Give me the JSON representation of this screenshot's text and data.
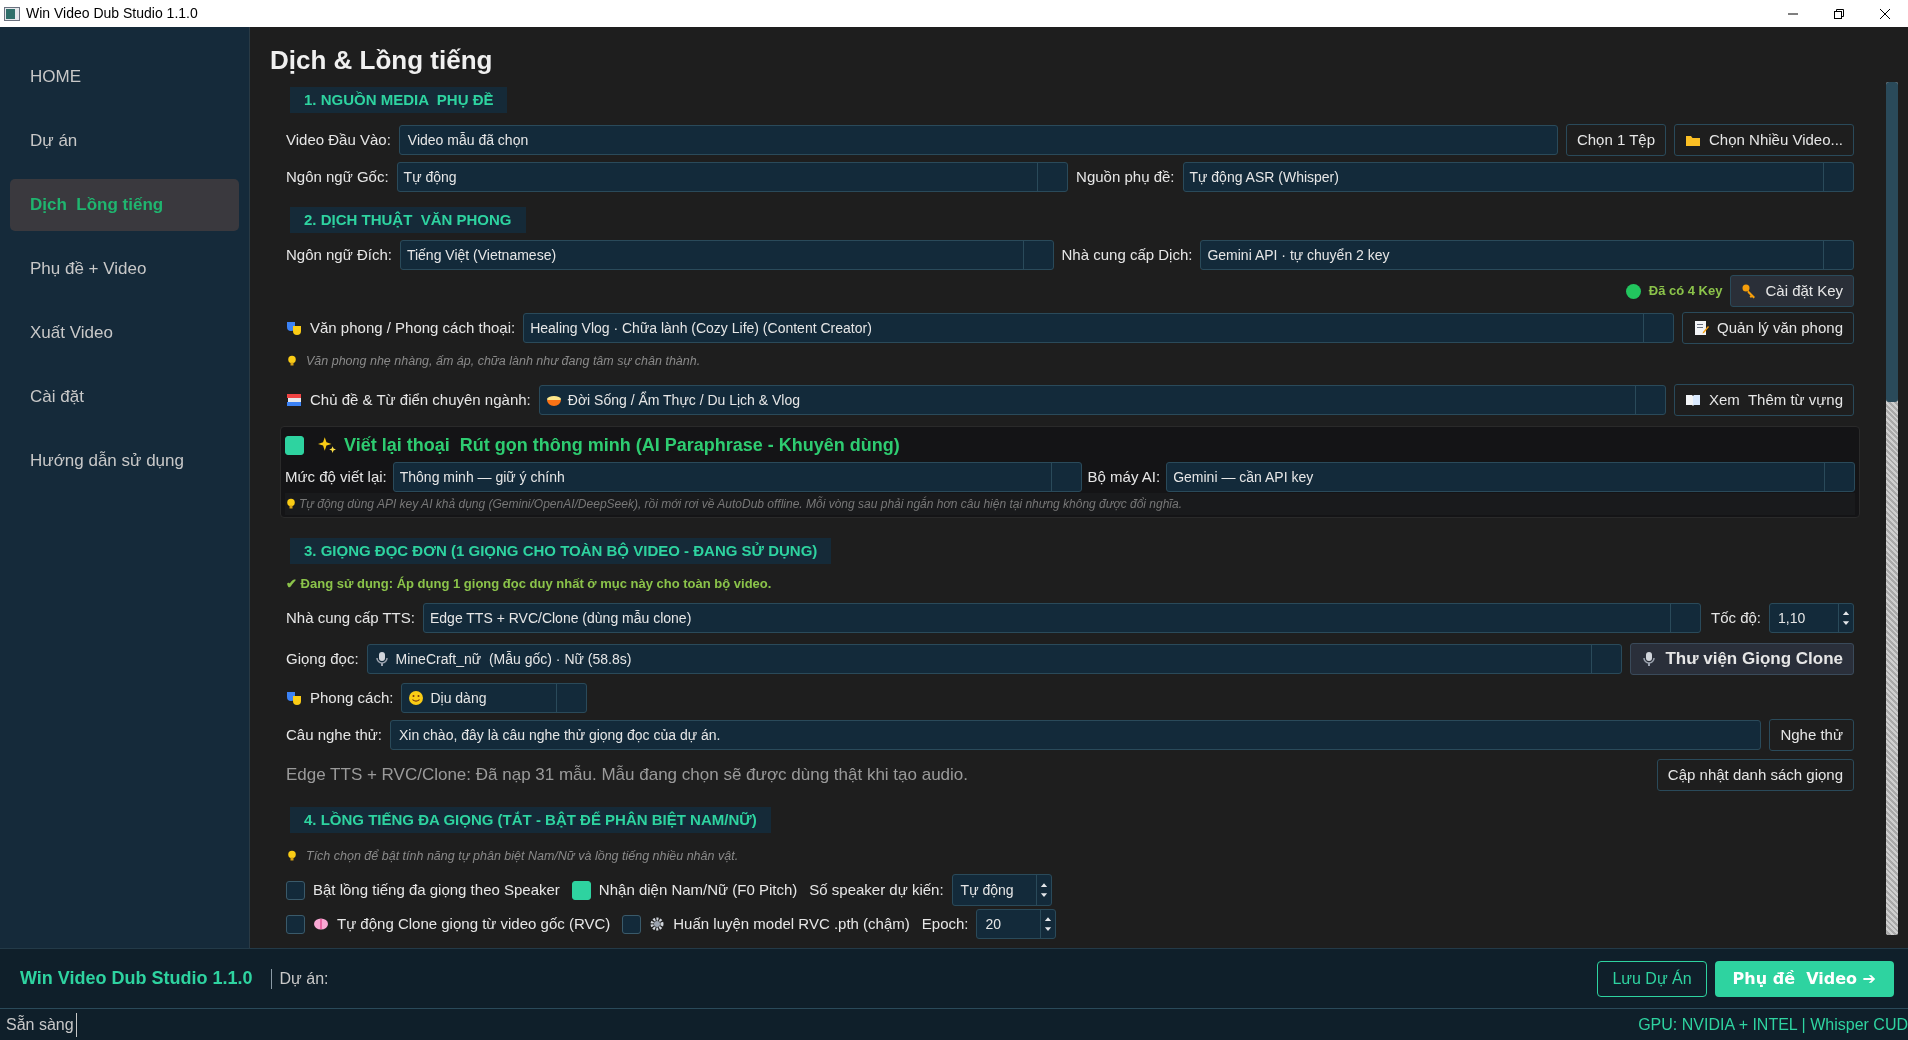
{
  "window": {
    "title": "Win Video Dub Studio 1.1.0"
  },
  "sidebar": {
    "items": [
      {
        "label": "HOME",
        "selected": false
      },
      {
        "label": "Dự án",
        "selected": false
      },
      {
        "label": "Dịch  Lồng tiếng",
        "selected": true
      },
      {
        "label": "Phụ đề + Video",
        "selected": false
      },
      {
        "label": "Xuất Video",
        "selected": false
      },
      {
        "label": "Cài đặt",
        "selected": false
      },
      {
        "label": "Hướng dẫn sử dụng",
        "selected": false
      }
    ]
  },
  "page_title": "Dịch & Lồng tiếng",
  "source_section": {
    "title": "1. NGUỒN MEDIA  PHỤ ĐỀ",
    "video_input": {
      "label": "Video Đầu Vào:",
      "value": "Video mẫu đã chọn"
    },
    "choose_file_button": "Chọn 1 Tệp",
    "choose_many_button": "Chọn Nhiều Video...",
    "source_language": {
      "label": "Ngôn ngữ Gốc:",
      "value": "Tự động"
    },
    "subtitle_source": {
      "label": "Nguồn phụ đề:",
      "value": "Tự động ASR (Whisper)"
    }
  },
  "translation_section": {
    "title": "2. DỊCH THUẬT  VĂN PHONG",
    "target_language": {
      "label": "Ngôn ngữ Đích:",
      "value": "Tiếng Việt (Vietnamese)"
    },
    "provider": {
      "label": "Nhà cung cấp Dịch:",
      "value": "Gemini API · tự chuyển 2 key"
    },
    "key_status": "Đã có 4 Key",
    "key_button": "Cài đặt Key",
    "style": {
      "label": "Văn phong / Phong cách thoại:",
      "value": "Healing Vlog · Chữa lành (Cozy Life) (Content Creator)"
    },
    "style_button": "Quản lý văn phong",
    "style_hint": "Văn phong nhẹ nhàng, ấm áp, chữa lành như đang tâm sự chân thành.",
    "topic": {
      "label": "Chủ đề & Từ điển chuyên ngành:",
      "value": "Đời Sống / Ẩm Thực / Du Lịch & Vlog"
    },
    "vocab_button": "Xem  Thêm từ vựng",
    "paraphrase": {
      "checked": true,
      "title": "Viết lại thoại  Rút gọn thông minh (AI Paraphrase - Khuyên dùng)",
      "rewrite_level": {
        "label": "Mức độ viết lại:",
        "value": "Thông minh — giữ ý chính"
      },
      "engine": {
        "label": "Bộ máy AI:",
        "value": "Gemini — cần API key"
      },
      "hint": "Tự động dùng API key AI khả dụng (Gemini/OpenAI/DeepSeek), rồi mới rơi về AutoDub offline. Mỗi vòng sau phải ngắn hơn câu hiện tại nhưng không được đổi nghĩa."
    }
  },
  "voice_section": {
    "title": "3. GIỌNG ĐỌC ĐƠN (1 GIỌNG CHO TOÀN BỘ VIDEO - ĐANG SỬ DỤNG)",
    "note": "✔ Đang sử dụng: Áp dụng 1 giọng đọc duy nhất ở mục này cho toàn bộ video.",
    "tts_provider": {
      "label": "Nhà cung cấp TTS:",
      "value": "Edge TTS + RVC/Clone (dùng mẫu clone)"
    },
    "speed": {
      "label": "Tốc độ:",
      "value": "1,10"
    },
    "voice": {
      "label": "Giọng đọc:",
      "value": "MineCraft_nữ  (Mẫu gốc) · Nữ (58.8s)"
    },
    "clone_library_button": "Thư viện Giọng Clone",
    "style": {
      "label": "Phong cách:",
      "value": "Dịu dàng"
    },
    "sample_text": {
      "label": "Câu nghe thử:",
      "value": "Xin chào, đây là câu nghe thử giọng đọc của dự án."
    },
    "listen_button": "Nghe thử",
    "info": "Edge TTS + RVC/Clone: Đã nạp 31 mẫu. Mẫu đang chọn sẽ được dùng thật khi tạo audio.",
    "refresh_button": "Cập nhật danh sách giọng"
  },
  "multi_voice_section": {
    "title": "4. LỒNG TIẾNG ĐA GIỌNG (TẮT - BẬT ĐỂ PHÂN BIỆT NAM/NỮ)",
    "hint": "Tích chọn để bật tính năng tự phân biệt Nam/Nữ và lồng tiếng nhiều nhân vật.",
    "options": [
      {
        "label": "Bật lồng tiếng đa giọng theo Speaker",
        "checked": false
      },
      {
        "label": "Nhận diện Nam/Nữ (F0 Pitch)",
        "checked": true
      }
    ],
    "speaker_count": {
      "label": "Số speaker dự kiến:",
      "value": "Tự động"
    },
    "clone_options": [
      {
        "label": "Tự động Clone giọng từ video gốc (RVC)",
        "checked": false
      },
      {
        "label": "Huấn luyện model RVC .pth (chậm)",
        "checked": false
      }
    ],
    "epoch": {
      "label": "Epoch:",
      "value": "20"
    }
  },
  "footer": {
    "app_name": "Win Video Dub Studio 1.1.0",
    "project_label": "Dự án:",
    "save_button": "Lưu Dự Án",
    "next_button": "Phụ đề  Video ➔"
  },
  "status_bar": {
    "left": "Sẵn sàng",
    "right": "GPU: NVIDIA + INTEL | Whisper CUD"
  }
}
